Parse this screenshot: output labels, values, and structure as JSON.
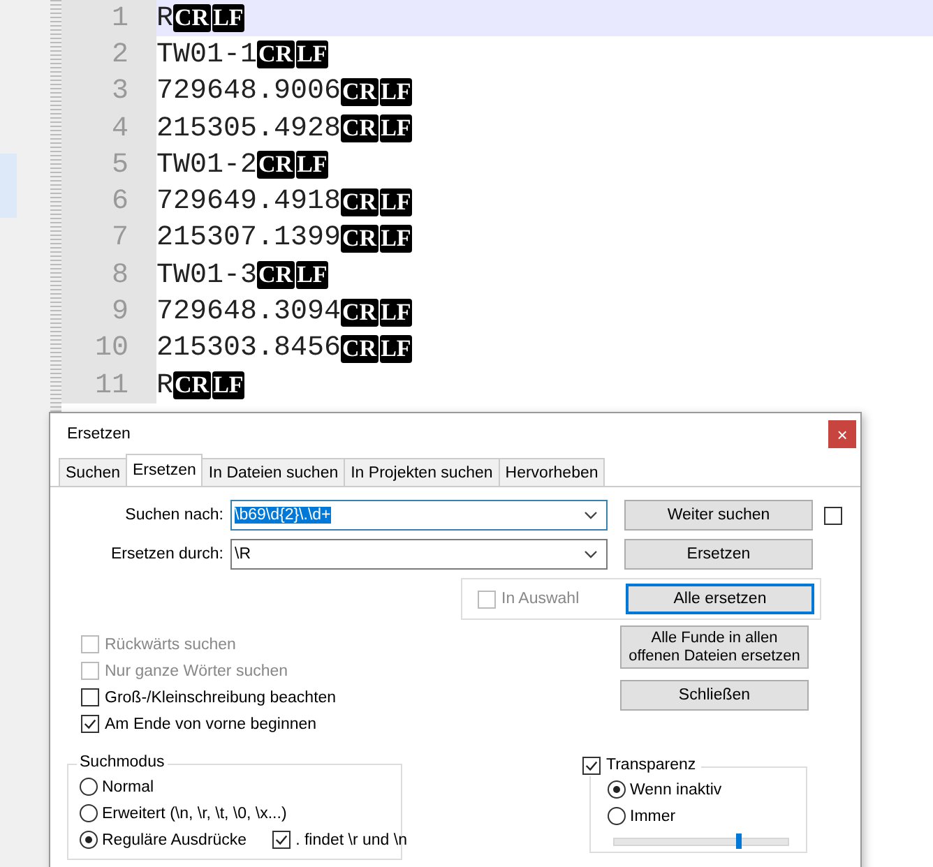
{
  "editor": {
    "lines": [
      {
        "number": "1",
        "text": "R",
        "eol": [
          "CR",
          "LF"
        ],
        "current": true
      },
      {
        "number": "2",
        "text": "TW01-1",
        "eol": [
          "CR",
          "LF"
        ],
        "current": false
      },
      {
        "number": "3",
        "text": "729648.9006",
        "eol": [
          "CR",
          "LF"
        ],
        "current": false
      },
      {
        "number": "4",
        "text": "215305.4928",
        "eol": [
          "CR",
          "LF"
        ],
        "current": false
      },
      {
        "number": "5",
        "text": "TW01-2",
        "eol": [
          "CR",
          "LF"
        ],
        "current": false
      },
      {
        "number": "6",
        "text": "729649.4918",
        "eol": [
          "CR",
          "LF"
        ],
        "current": false
      },
      {
        "number": "7",
        "text": "215307.1399",
        "eol": [
          "CR",
          "LF"
        ],
        "current": false
      },
      {
        "number": "8",
        "text": "TW01-3",
        "eol": [
          "CR",
          "LF"
        ],
        "current": false
      },
      {
        "number": "9",
        "text": "729648.3094",
        "eol": [
          "CR",
          "LF"
        ],
        "current": false
      },
      {
        "number": "10",
        "text": "215303.8456",
        "eol": [
          "CR",
          "LF"
        ],
        "current": false
      },
      {
        "number": "11",
        "text": "R",
        "eol": [
          "CR",
          "LF"
        ],
        "current": false
      }
    ]
  },
  "dialog": {
    "title": "Ersetzen",
    "close": "×",
    "tabs": [
      {
        "label": "Suchen",
        "selected": false
      },
      {
        "label": "Ersetzen",
        "selected": true
      },
      {
        "label": "In Dateien suchen",
        "selected": false
      },
      {
        "label": "In Projekten suchen",
        "selected": false
      },
      {
        "label": "Hervorheben",
        "selected": false
      }
    ],
    "search": {
      "label": "Suchen nach:",
      "value": "\\b69\\d{2}\\.\\d+",
      "selected": true
    },
    "replace": {
      "label": "Ersetzen durch:",
      "value": "\\R",
      "selected": false
    },
    "find_next": "Weiter suchen",
    "side_checkbox": {
      "checked": false
    },
    "replace_button": "Ersetzen",
    "in_selection": {
      "label": "In Auswahl",
      "checked": false,
      "disabled": true
    },
    "replace_all": "Alle ersetzen",
    "replace_all_open": "Alle Funde in allen offenen Dateien ersetzen",
    "close_button": "Schließen",
    "options": [
      {
        "label": "Rückwärts suchen",
        "checked": false,
        "disabled": true
      },
      {
        "label": "Nur ganze Wörter suchen",
        "checked": false,
        "disabled": true
      },
      {
        "label": "Groß-/Kleinschreibung beachten",
        "checked": false,
        "disabled": false
      },
      {
        "label": "Am Ende von vorne beginnen",
        "checked": true,
        "disabled": false
      }
    ],
    "search_mode": {
      "title": "Suchmodus",
      "modes": [
        {
          "label": "Normal",
          "selected": false
        },
        {
          "label": "Erweitert (\\n, \\r, \\t, \\0, \\x...)",
          "selected": false
        },
        {
          "label": "Reguläre Ausdrücke",
          "selected": true
        }
      ],
      "dot_newline": {
        "label": ". findet \\r und \\n",
        "checked": true
      }
    },
    "transparency": {
      "label": "Transparenz",
      "checked": true,
      "modes": [
        {
          "label": "Wenn inaktiv",
          "selected": true
        },
        {
          "label": "Immer",
          "selected": false
        }
      ],
      "level": 0.72
    }
  }
}
